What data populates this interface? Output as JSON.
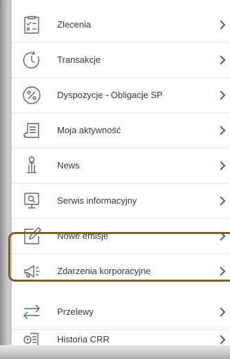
{
  "menu": {
    "items": [
      {
        "label": "Zlecenia",
        "icon": "order-list-icon"
      },
      {
        "label": "Transakcje",
        "icon": "history-clock-icon"
      },
      {
        "label": "Dyspozycje - Obligacje SP",
        "icon": "percent-icon"
      },
      {
        "label": "Moja aktywność",
        "icon": "document-list-icon"
      },
      {
        "label": "News",
        "icon": "news-stand-icon"
      },
      {
        "label": "Serwis informacyjny",
        "icon": "monitor-search-icon"
      },
      {
        "label": "Nowe emisje",
        "icon": "edit-document-icon"
      },
      {
        "label": "Zdarzenia korporacyjne",
        "icon": "megaphone-icon"
      },
      {
        "label": "Przelewy",
        "icon": "transfer-arrows-icon"
      },
      {
        "label": "Historia CRR",
        "icon": "report-history-icon"
      }
    ],
    "highlighted_item": "Zdarzenia korporacyjne"
  },
  "colors": {
    "icon_stroke": "#56667a",
    "text": "#2f3a4a",
    "chevron": "#2f4f7f",
    "highlight_border": "#7a6128"
  }
}
